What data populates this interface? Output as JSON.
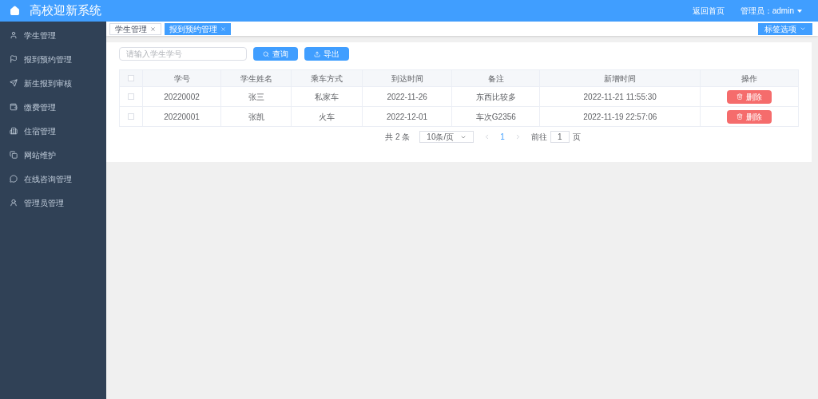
{
  "header": {
    "title": "高校迎新系统",
    "links": [
      "返回首页"
    ],
    "user": "管理员：admin"
  },
  "sidebar": {
    "items": [
      {
        "label": "学生管理",
        "selected": false
      },
      {
        "label": "报到预约管理",
        "selected": false
      },
      {
        "label": "新生报到审核",
        "selected": false
      },
      {
        "label": "缴费管理",
        "selected": false
      },
      {
        "label": "住宿管理",
        "selected": false
      },
      {
        "label": "网站维护",
        "selected": false
      },
      {
        "label": "在线咨询管理",
        "selected": false
      },
      {
        "label": "管理员管理",
        "selected": false
      }
    ]
  },
  "tabs": [
    {
      "label": "学生管理",
      "selected": false
    },
    {
      "label": "报到预约管理",
      "selected": true
    }
  ],
  "tab_options": "标签选项",
  "search": {
    "placeholder": "请输入学生学号"
  },
  "buttons": [
    {
      "label": "查询",
      "kind": "search"
    },
    {
      "label": "导出",
      "kind": "export"
    }
  ],
  "table": {
    "select_all_checked": false,
    "columns": [
      "学号",
      "学生姓名",
      "乘车方式",
      "到达时间",
      "备注",
      "新增时间",
      "操作"
    ],
    "rows": [
      {
        "checked": false,
        "cells": [
          "20220002",
          "张三",
          "私家车",
          "2022-11-26",
          "东西比较多",
          "2022-11-21 11:55:30"
        ],
        "action": "删除"
      },
      {
        "checked": false,
        "cells": [
          "20220001",
          "张凯",
          "火车",
          "2022-12-01",
          "车次G2356",
          "2022-11-19 22:57:06"
        ],
        "action": "删除"
      }
    ]
  },
  "pagination": {
    "total": "共 2 条",
    "page_size": "10条/页",
    "pages": [
      {
        "label": "1",
        "selected": true
      }
    ],
    "goto_label": "前往",
    "goto_value": "1",
    "goto_suffix": "页"
  }
}
